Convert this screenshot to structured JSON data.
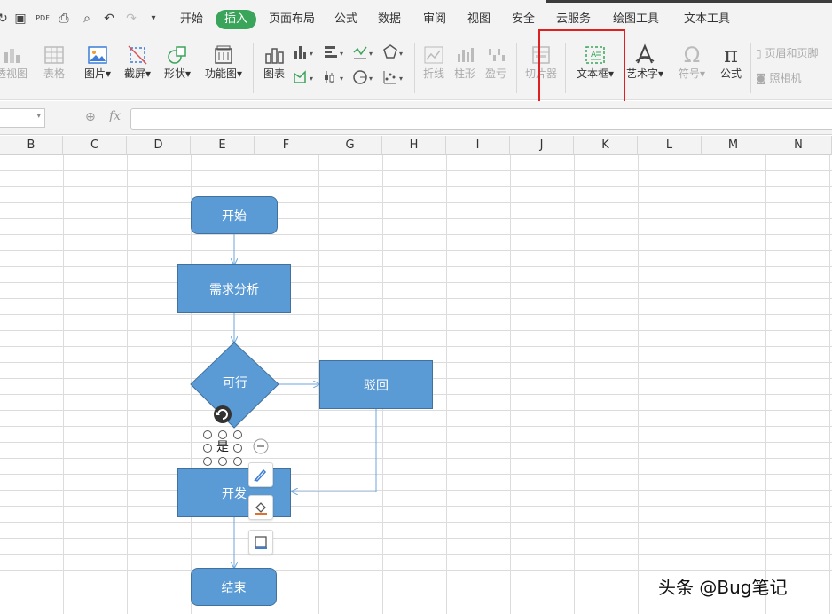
{
  "menu": {
    "tabs": [
      "开始",
      "插入",
      "页面布局",
      "公式",
      "数据",
      "审阅",
      "视图",
      "安全",
      "云服务",
      "绘图工具",
      "文本工具"
    ],
    "active_tab": "插入"
  },
  "ribbon": {
    "pivot_view": "透视图",
    "table": "表格",
    "picture": "图片",
    "screenshot": "截屏",
    "shapes": "形状",
    "function_chart": "功能图",
    "chart": "图表",
    "line": "折线",
    "column": "柱形",
    "winloss": "盈亏",
    "slicer": "切片器",
    "textbox": "文本框",
    "wordart": "艺术字",
    "symbol": "符号",
    "formula": "公式",
    "header_footer": "页眉和页脚",
    "camera": "照相机"
  },
  "formula_bar": {
    "fx": "fx",
    "value": ""
  },
  "columns": [
    "B",
    "C",
    "D",
    "E",
    "F",
    "G",
    "H",
    "I",
    "J",
    "K",
    "L",
    "M",
    "N"
  ],
  "flowchart": {
    "start": "开始",
    "analysis": "需求分析",
    "decision": "可行",
    "reject": "驳回",
    "develop": "开发",
    "end": "结束",
    "yes_label": "是"
  },
  "colors": {
    "accent": "#3aa55a",
    "shape_fill": "#5b9bd5",
    "shape_border": "#41719c",
    "connector": "#6ea6d8",
    "highlight": "#e02020"
  },
  "watermark": "头条 @Bug笔记"
}
